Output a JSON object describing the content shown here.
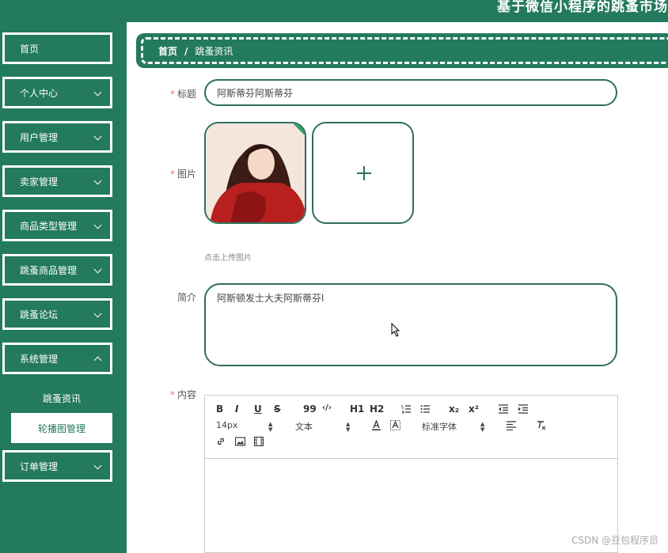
{
  "header": {
    "title": "基于微信小程序的跳蚤市场"
  },
  "sidebar": {
    "items": [
      {
        "label": "首页"
      },
      {
        "label": "个人中心"
      },
      {
        "label": "用户管理"
      },
      {
        "label": "卖家管理"
      },
      {
        "label": "商品类型管理"
      },
      {
        "label": "跳蚤商品管理"
      },
      {
        "label": "跳蚤论坛"
      },
      {
        "label": "系统管理"
      },
      {
        "label": "订单管理"
      }
    ],
    "submenu": [
      {
        "label": "跳蚤资讯"
      },
      {
        "label": "轮播图管理"
      }
    ]
  },
  "breadcrumb": {
    "home": "首页",
    "separator": "/",
    "current": "跳蚤资讯"
  },
  "form": {
    "title": {
      "label": "标题",
      "value": "阿斯蒂芬阿斯蒂芬"
    },
    "image": {
      "label": "图片",
      "hint": "点击上传图片"
    },
    "intro": {
      "label": "简介",
      "value": "阿斯顿发士大夫阿斯蒂芬l"
    },
    "content": {
      "label": "内容"
    },
    "required_mark": "*"
  },
  "editor": {
    "bold": "B",
    "italic": "I",
    "underline": "U",
    "strike": "S",
    "quote": "99",
    "code": "‹/›",
    "h1": "H1",
    "h2": "H2",
    "sub": "x₂",
    "sup": "x²",
    "font_size": "14px",
    "text_type": "文本",
    "font_family": "标准字体"
  },
  "watermark": "CSDN @豆包程序员",
  "colors": {
    "primary": "#237a5c",
    "border": "#2f6f5a",
    "required": "#f56c6c"
  }
}
